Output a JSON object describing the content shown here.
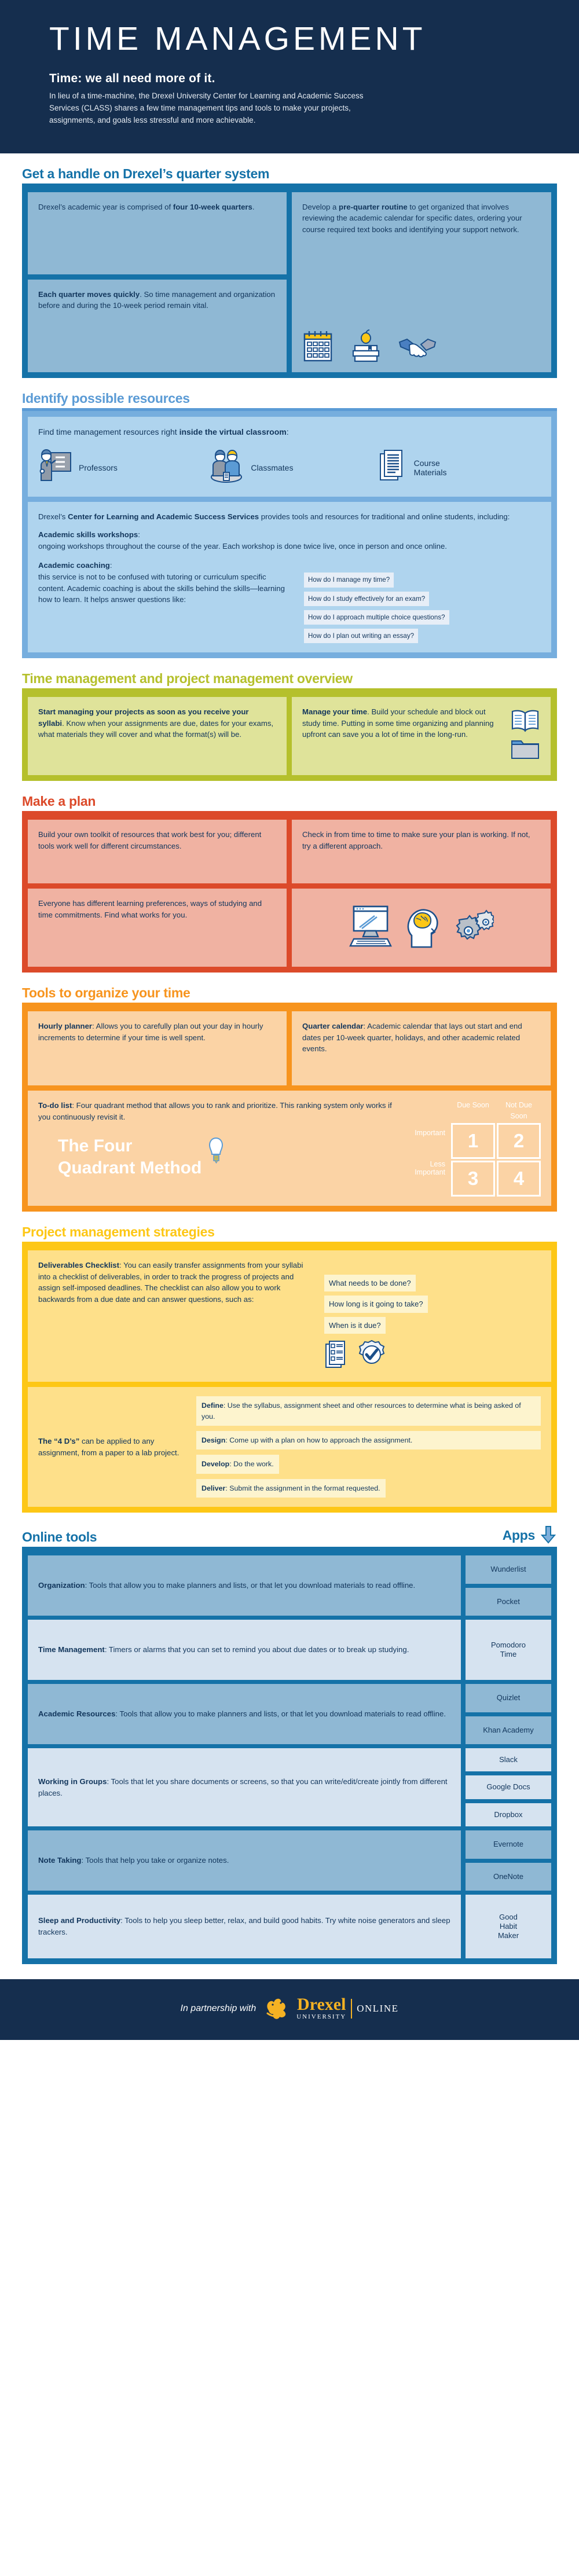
{
  "hero": {
    "title": "TIME MANAGEMENT",
    "subtitle": "Time: we all need more of it.",
    "body": "In lieu of a time-machine, the Drexel University Center for Learning and Academic Success Services (CLASS) shares a few time management tips and tools to make your projects, assignments, and goals less stressful and more achievable."
  },
  "colors": {
    "navy": "#152E4E",
    "blue": "#1572A8",
    "light_blue": "#5B9BD5",
    "green": "#B5C02C",
    "red": "#DC4A2A",
    "orange": "#F7941E",
    "yellow": "#FDC716",
    "gold": "#F5B223"
  },
  "quarter": {
    "heading": "Get a handle on Drexel’s quarter system",
    "card1_pre": "Drexel’s academic year is comprised of ",
    "card1_bold": "four 10-week quarters",
    "card1_post": ".",
    "card2_bold": "Each quarter moves quickly",
    "card2_post": ". So time management and organization before and during the 10-week period remain vital.",
    "card3_pre": "Develop a ",
    "card3_bold": "pre-quarter routine",
    "card3_post": " to get organized that involves reviewing the academic calendar for specific dates, ordering your course required text books and identifying your support network."
  },
  "resources": {
    "heading": "Identify possible resources",
    "intro_pre": "Find time management resources right ",
    "intro_bold": "inside the virtual classroom",
    "intro_post": ":",
    "items": [
      {
        "label": "Professors",
        "icon": "professor-icon"
      },
      {
        "label": "Classmates",
        "icon": "classmates-icon"
      },
      {
        "label": "Course\nMaterials",
        "icon": "course-materials-icon"
      }
    ],
    "class_pre": "Drexel’s ",
    "class_bold": "Center for Learning and Academic Success Services",
    "class_post": " provides tools and resources for traditional and online students, including:",
    "workshops_title": "Academic skills workshops",
    "workshops_body": "ongoing workshops throughout the course of the year. Each workshop is done twice live, once in person and once online.",
    "coaching_title": "Academic coaching",
    "coaching_body": "this service is not to be confused with tutoring or curriculum specific content. Academic coaching is about the skills behind the skills—learning how to learn. It helps answer questions like:",
    "questions": [
      "How do I manage my time?",
      "How do I study effectively for an exam?",
      "How do I approach multiple choice questions?",
      "How do I plan out writing an essay?"
    ]
  },
  "overview": {
    "heading": "Time management and project management overview",
    "card1_bold": "Start managing your projects as soon as you receive your syllabi",
    "card1_post": ". Know when your assignments are due, dates for your exams, what materials they will cover and what the format(s) will be.",
    "card2_bold": "Manage your time",
    "card2_post": ". Build your schedule and block out study time. Putting in some time organizing and planning upfront can save you a lot of time in the long-run."
  },
  "plan": {
    "heading": "Make a plan",
    "card1": "Build your own toolkit of resources that work best for you; different tools work well for different circumstances.",
    "card2": "Check in from time to time to make sure your plan is working. If not, try a different approach.",
    "card3": "Everyone has different learning preferences, ways of studying and time commitments. Find what works for you."
  },
  "tools": {
    "heading": "Tools to organize your time",
    "card1_bold": "Hourly planner",
    "card1_post": ": Allows you to carefully plan out your day in hourly increments to determine if your time is well spent.",
    "card2_bold": "Quarter calendar",
    "card2_post": ": Academic calendar that lays out start and end dates per 10-week quarter, holidays, and other academic related events.",
    "card3_bold": "To-do list",
    "card3_post": ": Four quadrant method that allows you to rank and prioritize. This ranking system only works if you continuously revisit it.",
    "fqm_line1": "The Four",
    "fqm_line2": "Quadrant Method",
    "quadrant": {
      "col_headers": [
        "Due Soon",
        "Not Due Soon"
      ],
      "row_headers": [
        "Important",
        "Less Important"
      ],
      "cells": [
        "1",
        "2",
        "3",
        "4"
      ]
    }
  },
  "projects": {
    "heading": "Project management strategies",
    "deliv_bold": "Deliverables Checklist",
    "deliv_post": ": You can easily transfer assignments from your syllabi into a checklist of deliverables, in order to track the progress of projects and assign self-imposed deadlines. The checklist can also allow you to work backwards from a due date and can answer questions, such as:",
    "deliv_questions": [
      "What needs to be done?",
      "How long is it going to take?",
      "When is it due?"
    ],
    "dds_bold": "The “4 D’s”",
    "dds_post": " can be applied to any assignment, from a paper to a lab project.",
    "dds": [
      {
        "term": "Define",
        "text": ": Use the syllabus, assignment sheet and other resources to determine what is being asked of you."
      },
      {
        "term": "Design",
        "text": ": Come up with a plan on how to approach the assignment."
      },
      {
        "term": "Develop",
        "text": ": Do the work."
      },
      {
        "term": "Deliver",
        "text": ": Submit the assignment in the format requested."
      }
    ]
  },
  "online": {
    "heading": "Online tools",
    "apps_label": "Apps",
    "rows": [
      {
        "term": "Organization",
        "text": ": Tools that allow you to make planners and lists, or that let you download materials to read offline.",
        "apps": [
          "Wunderlist",
          "Pocket"
        ]
      },
      {
        "term": "Time Management",
        "text": ": Timers or alarms that you can set to remind you about due dates or to break up studying.",
        "apps": [
          "Pomodoro Time"
        ]
      },
      {
        "term": "Academic Resources",
        "text": ": Tools that allow you to make planners and lists, or that let you download materials to read offline.",
        "apps": [
          "Quizlet",
          "Khan Academy"
        ]
      },
      {
        "term": "Working in Groups",
        "text": ": Tools that let you share documents or screens, so that you can write/edit/create jointly from different places.",
        "apps": [
          "Slack",
          "Google Docs",
          "Dropbox"
        ]
      },
      {
        "term": "Note Taking",
        "text": ": Tools that help you take or organize notes.",
        "apps": [
          "Evernote",
          "OneNote"
        ]
      },
      {
        "term": "Sleep and Productivity",
        "text": ": Tools to help you sleep better, relax, and build good habits. Try white noise generators and sleep trackers.",
        "apps": [
          "Good Habit Maker"
        ]
      }
    ]
  },
  "footer": {
    "partnership": "In partnership with",
    "brand": "Drexel",
    "brand_sub": "UNIVERSITY",
    "brand_online": "ONLINE"
  }
}
